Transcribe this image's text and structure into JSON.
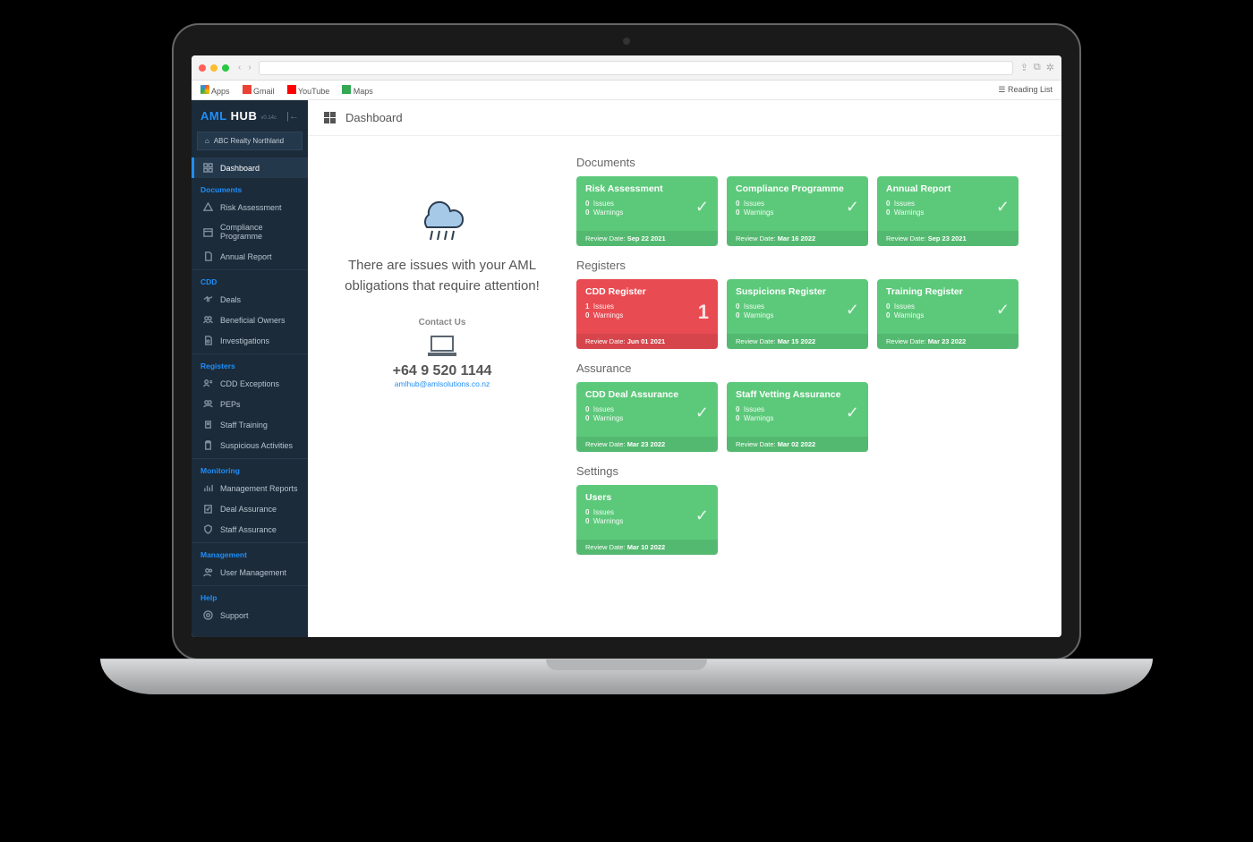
{
  "browser": {
    "bookmarks_label": "Apps",
    "bm_gmail": "Gmail",
    "bm_youtube": "YouTube",
    "bm_maps": "Maps",
    "reading_list": "Reading List"
  },
  "logo": {
    "part1": "AML",
    "part2": "HUB",
    "sub": "v0.14c"
  },
  "tenant": "ABC Realty Northland",
  "sidebar": {
    "dashboard": "Dashboard",
    "groups": {
      "documents": {
        "head": "Documents",
        "items": [
          "Risk Assessment",
          "Compliance Programme",
          "Annual Report"
        ]
      },
      "cdd": {
        "head": "CDD",
        "items": [
          "Deals",
          "Beneficial Owners",
          "Investigations"
        ]
      },
      "registers": {
        "head": "Registers",
        "items": [
          "CDD Exceptions",
          "PEPs",
          "Staff Training",
          "Suspicious Activities"
        ]
      },
      "monitoring": {
        "head": "Monitoring",
        "items": [
          "Management Reports",
          "Deal Assurance",
          "Staff Assurance"
        ]
      },
      "management": {
        "head": "Management",
        "items": [
          "User Management"
        ]
      },
      "help": {
        "head": "Help",
        "items": [
          "Support"
        ]
      }
    }
  },
  "page_title": "Dashboard",
  "status": {
    "message": "There are issues with your AML obligations that require attention!",
    "contact_heading": "Contact Us",
    "phone": "+64 9 520 1144",
    "email": "amlhub@amlsolutions.co.nz"
  },
  "labels": {
    "issues": "Issues",
    "warnings": "Warnings",
    "review_date": "Review Date:"
  },
  "sections": {
    "documents": {
      "title": "Documents",
      "cards": [
        {
          "title": "Risk Assessment",
          "issues": 0,
          "warnings": 0,
          "review": "Sep 22 2021",
          "status": "ok"
        },
        {
          "title": "Compliance Programme",
          "issues": 0,
          "warnings": 0,
          "review": "Mar 16 2022",
          "status": "ok"
        },
        {
          "title": "Annual Report",
          "issues": 0,
          "warnings": 0,
          "review": "Sep 23 2021",
          "status": "ok"
        }
      ]
    },
    "registers": {
      "title": "Registers",
      "cards": [
        {
          "title": "CDD Register",
          "issues": 1,
          "warnings": 0,
          "review": "Jun 01 2021",
          "status": "bad",
          "badge": "1"
        },
        {
          "title": "Suspicions Register",
          "issues": 0,
          "warnings": 0,
          "review": "Mar 15 2022",
          "status": "ok"
        },
        {
          "title": "Training Register",
          "issues": 0,
          "warnings": 0,
          "review": "Mar 23 2022",
          "status": "ok"
        }
      ]
    },
    "assurance": {
      "title": "Assurance",
      "cards": [
        {
          "title": "CDD Deal Assurance",
          "issues": 0,
          "warnings": 0,
          "review": "Mar 23 2022",
          "status": "ok"
        },
        {
          "title": "Staff Vetting Assurance",
          "issues": 0,
          "warnings": 0,
          "review": "Mar 02 2022",
          "status": "ok"
        }
      ]
    },
    "settings": {
      "title": "Settings",
      "cards": [
        {
          "title": "Users",
          "issues": 0,
          "warnings": 0,
          "review": "Mar 10 2022",
          "status": "ok"
        }
      ]
    }
  }
}
